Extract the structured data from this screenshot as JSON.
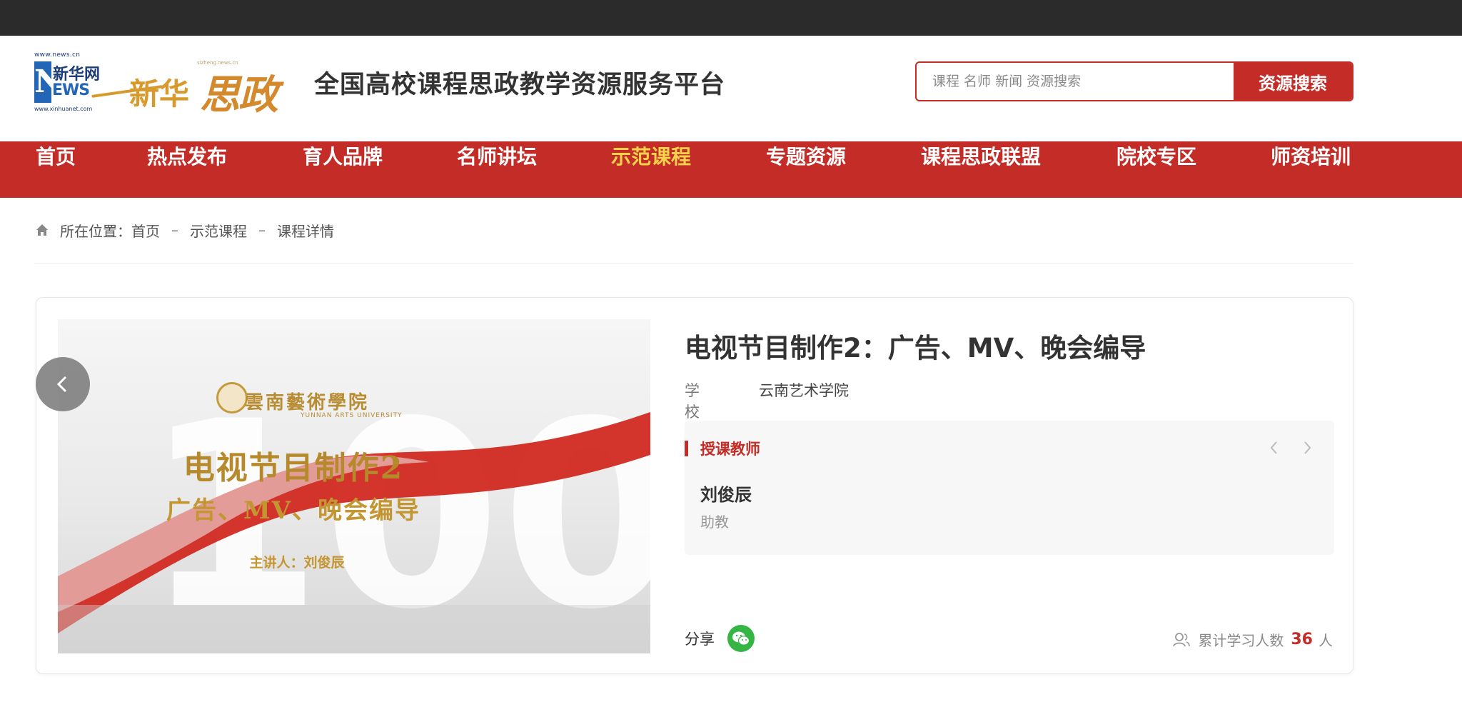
{
  "logo": {
    "url_top": "www.news.cn",
    "n": "N",
    "xh_cn": "新华网",
    "ews": "EWS",
    "url_bottom": "www.xinhuanet.com",
    "xinhua": "新华",
    "sizheng": "思政",
    "tiny": "sizheng.news.cn"
  },
  "site_title": "全国高校课程思政教学资源服务平台",
  "search": {
    "placeholder": "课程 名师 新闻 资源搜索",
    "button_label": "资源搜索"
  },
  "nav": {
    "items": [
      "首页",
      "热点发布",
      "育人品牌",
      "名师讲坛",
      "示范课程",
      "专题资源",
      "课程思政联盟",
      "院校专区",
      "师资培训"
    ],
    "active": "示范课程"
  },
  "breadcrumb": {
    "prefix": "所在位置：",
    "items": [
      "首页",
      "示范课程",
      "课程详情"
    ],
    "separator": "–"
  },
  "course": {
    "title": "电视节目制作2：广告、MV、晚会编导",
    "school_label": "学校",
    "school": "云南艺术学院",
    "cover": {
      "university_cn": "雲南藝術學院",
      "university_en": "YUNNAN ARTS UNIVERSITY",
      "title": "电视节目制作2",
      "subtitle": "广告、MV、晚会编导",
      "host": "主讲人：刘俊辰",
      "big_number": "100"
    },
    "teacher_section_label": "授课教师",
    "teacher_name": "刘俊辰",
    "teacher_role": "助教",
    "share_label": "分享",
    "learners_label": "累计学习人数",
    "learners_count": "36",
    "learners_unit": "人"
  },
  "colors": {
    "brand_red": "#c42d27",
    "nav_active": "#f4d34a",
    "wechat_green": "#35b544",
    "logo_gold": "#d89a2c"
  }
}
